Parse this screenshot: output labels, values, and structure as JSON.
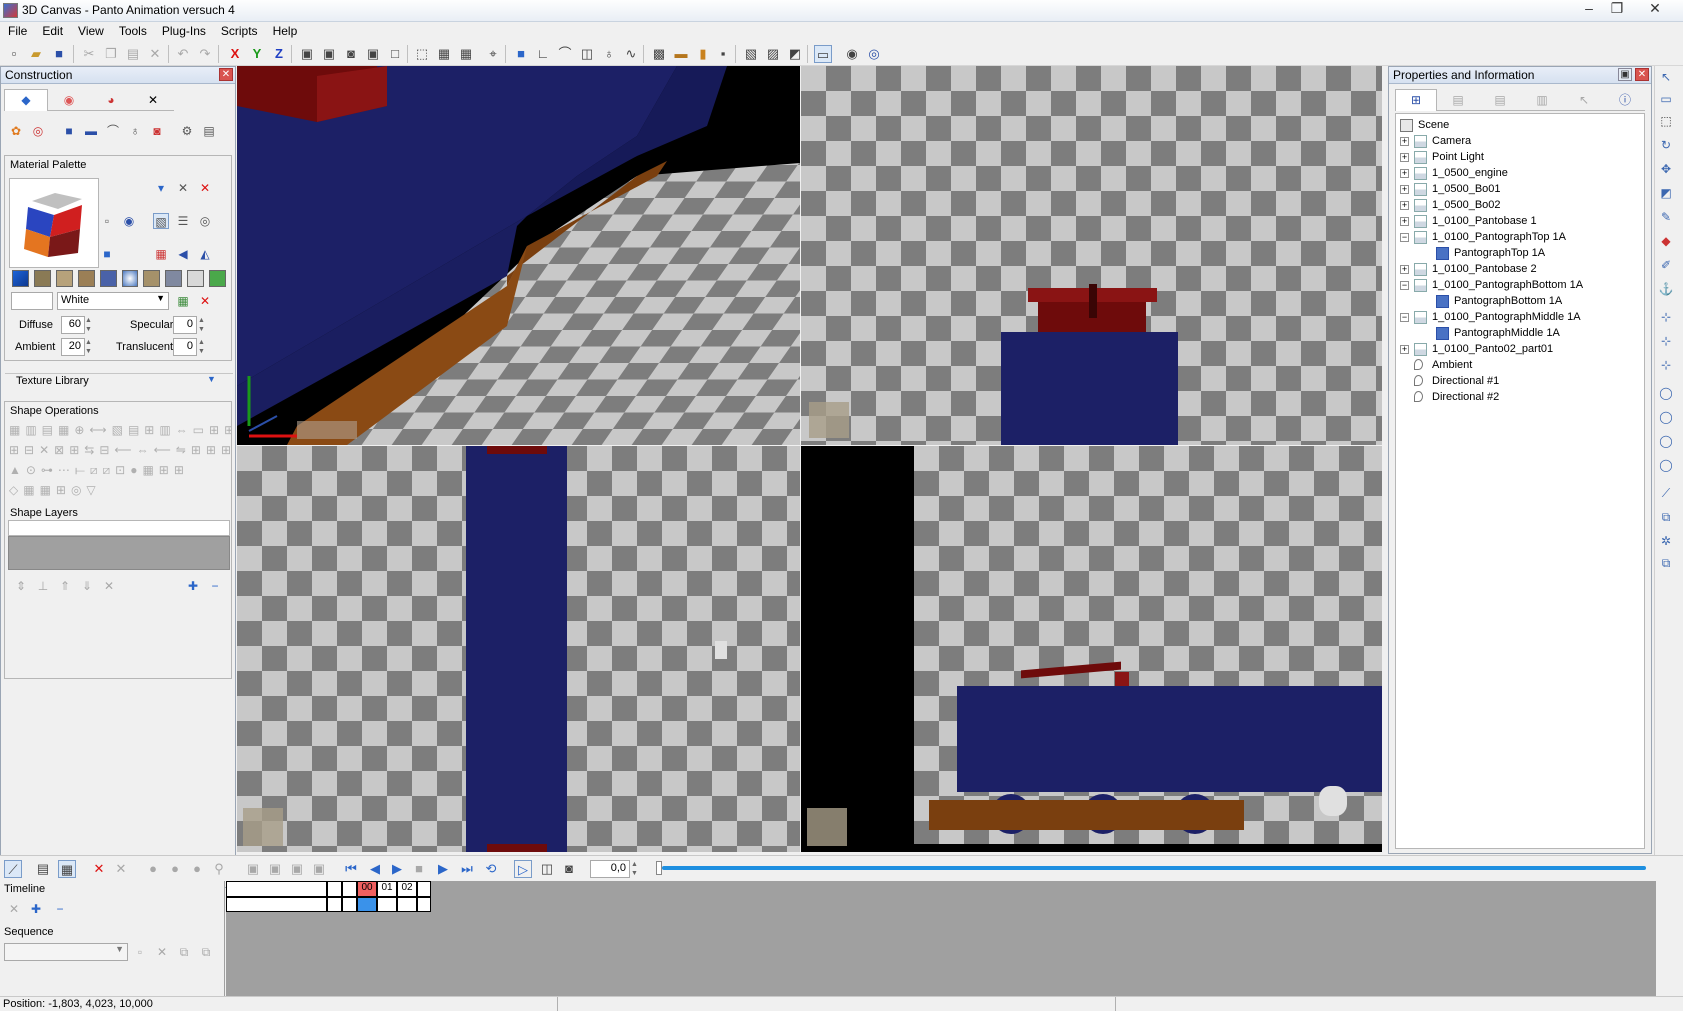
{
  "window": {
    "title": "3D Canvas - Panto Animation versuch 4",
    "controls": [
      "‒",
      "❐",
      "✕"
    ]
  },
  "menu": [
    "File",
    "Edit",
    "View",
    "Tools",
    "Plug-Ins",
    "Scripts",
    "Help"
  ],
  "toolbar": {
    "axis_x": "X",
    "axis_y": "Y",
    "axis_z": "Z"
  },
  "construction": {
    "title": "Construction",
    "close": "✕",
    "material_palette": {
      "title": "Material Palette",
      "material_name": "White",
      "diffuse_label": "Diffuse",
      "diffuse_value": "60",
      "specular_label": "Specular",
      "specular_value": "0",
      "ambient_label": "Ambient",
      "ambient_value": "20",
      "translucent_label": "Translucent",
      "translucent_value": "0",
      "texture_library": "Texture Library"
    },
    "shape_operations": {
      "title": "Shape Operations"
    },
    "shape_layers": {
      "title": "Shape Layers"
    }
  },
  "properties": {
    "title": "Properties and Information",
    "tree": [
      {
        "label": "Scene",
        "level": 0,
        "expander": "",
        "icon": "scene"
      },
      {
        "label": "Camera",
        "level": 1,
        "expander": "+",
        "icon": "group"
      },
      {
        "label": "Point Light",
        "level": 1,
        "expander": "+",
        "icon": "group"
      },
      {
        "label": "1_0500_engine",
        "level": 1,
        "expander": "+",
        "icon": "group"
      },
      {
        "label": "1_0500_Bo01",
        "level": 1,
        "expander": "+",
        "icon": "group"
      },
      {
        "label": "1_0500_Bo02",
        "level": 1,
        "expander": "+",
        "icon": "group"
      },
      {
        "label": "1_0100_Pantobase 1",
        "level": 1,
        "expander": "+",
        "icon": "group"
      },
      {
        "label": "1_0100_PantographTop 1A",
        "level": 1,
        "expander": "−",
        "icon": "group"
      },
      {
        "label": "PantographTop 1A",
        "level": 2,
        "expander": "",
        "icon": "shape"
      },
      {
        "label": "1_0100_Pantobase 2",
        "level": 1,
        "expander": "+",
        "icon": "group"
      },
      {
        "label": "1_0100_PantographBottom 1A",
        "level": 1,
        "expander": "−",
        "icon": "group"
      },
      {
        "label": "PantographBottom 1A",
        "level": 2,
        "expander": "",
        "icon": "shape"
      },
      {
        "label": "1_0100_PantographMiddle 1A",
        "level": 1,
        "expander": "−",
        "icon": "group"
      },
      {
        "label": "PantographMiddle 1A",
        "level": 2,
        "expander": "",
        "icon": "shape"
      },
      {
        "label": "1_0100_Panto02_part01",
        "level": 1,
        "expander": "+",
        "icon": "group"
      },
      {
        "label": "Ambient",
        "level": 1,
        "expander": "",
        "icon": "light"
      },
      {
        "label": "Directional #1",
        "level": 1,
        "expander": "",
        "icon": "light"
      },
      {
        "label": "Directional #2",
        "level": 1,
        "expander": "",
        "icon": "light"
      }
    ]
  },
  "animation": {
    "time_value": "0,0",
    "timeline_label": "Timeline",
    "sequence_label": "Sequence",
    "frames": [
      "00",
      "01",
      "02"
    ]
  },
  "status": {
    "position": "Position: -1,803, 4,023, 10,000"
  },
  "colors": {
    "train_body": "#1c2066",
    "roof_red": "#6e0b0b",
    "wood": "#7a3f0f",
    "checker_dark": "#7d7d7d",
    "checker_light": "#c8c8c8",
    "accent_blue": "#1e8fe0"
  }
}
